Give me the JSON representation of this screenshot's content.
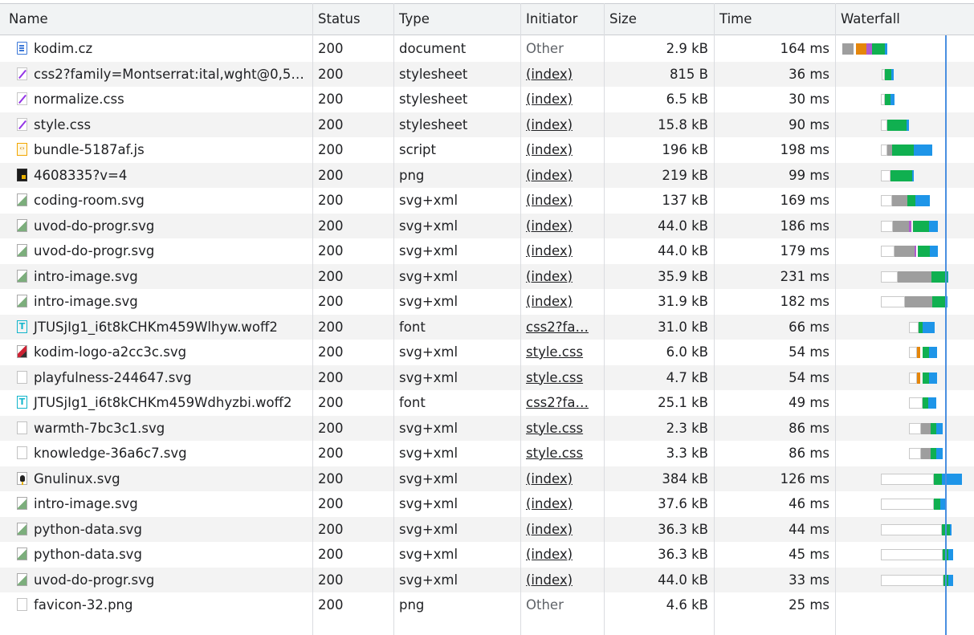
{
  "columns": {
    "name": "Name",
    "status": "Status",
    "type": "Type",
    "initiator": "Initiator",
    "size": "Size",
    "time": "Time",
    "waterfall": "Waterfall"
  },
  "colors": {
    "queueing": "#ffffff",
    "stalled": "#9e9e9e",
    "ssl": "#e5860b",
    "connect": "#b05ad0",
    "waiting": "#10b050",
    "download": "#1e95e8",
    "load_marker": "#4a8fe0",
    "row_alt": "#f3f3f3"
  },
  "requests": [
    {
      "name": "kodim.cz",
      "icon": "document-icon",
      "status": "200",
      "type": "document",
      "initiator": "Other",
      "initiator_link": false,
      "size": "2.9 kB",
      "time": "164 ms"
    },
    {
      "name": "css2?family=Montserrat:ital,wght@0,5…",
      "icon": "stylesheet-icon",
      "status": "200",
      "type": "stylesheet",
      "initiator": "(index)",
      "initiator_link": true,
      "size": "815 B",
      "time": "36 ms"
    },
    {
      "name": "normalize.css",
      "icon": "stylesheet-icon",
      "status": "200",
      "type": "stylesheet",
      "initiator": "(index)",
      "initiator_link": true,
      "size": "6.5 kB",
      "time": "30 ms"
    },
    {
      "name": "style.css",
      "icon": "stylesheet-icon",
      "status": "200",
      "type": "stylesheet",
      "initiator": "(index)",
      "initiator_link": true,
      "size": "15.8 kB",
      "time": "90 ms"
    },
    {
      "name": "bundle-5187af.js",
      "icon": "script-icon",
      "status": "200",
      "type": "script",
      "initiator": "(index)",
      "initiator_link": true,
      "size": "196 kB",
      "time": "198 ms"
    },
    {
      "name": "4608335?v=4",
      "icon": "png-thumbnail-icon",
      "status": "200",
      "type": "png",
      "initiator": "(index)",
      "initiator_link": true,
      "size": "219 kB",
      "time": "99 ms"
    },
    {
      "name": "coding-room.svg",
      "icon": "image-icon",
      "status": "200",
      "type": "svg+xml",
      "initiator": "(index)",
      "initiator_link": true,
      "size": "137 kB",
      "time": "169 ms"
    },
    {
      "name": "uvod-do-progr.svg",
      "icon": "image-icon",
      "status": "200",
      "type": "svg+xml",
      "initiator": "(index)",
      "initiator_link": true,
      "size": "44.0 kB",
      "time": "186 ms"
    },
    {
      "name": "uvod-do-progr.svg",
      "icon": "image-icon",
      "status": "200",
      "type": "svg+xml",
      "initiator": "(index)",
      "initiator_link": true,
      "size": "44.0 kB",
      "time": "179 ms"
    },
    {
      "name": "intro-image.svg",
      "icon": "image-icon",
      "status": "200",
      "type": "svg+xml",
      "initiator": "(index)",
      "initiator_link": true,
      "size": "35.9 kB",
      "time": "231 ms"
    },
    {
      "name": "intro-image.svg",
      "icon": "image-icon",
      "status": "200",
      "type": "svg+xml",
      "initiator": "(index)",
      "initiator_link": true,
      "size": "31.9 kB",
      "time": "182 ms"
    },
    {
      "name": "JTUSjIg1_i6t8kCHKm459Wlhyw.woff2",
      "icon": "font-icon",
      "status": "200",
      "type": "font",
      "initiator": "css2?fa…",
      "initiator_link": true,
      "size": "31.0 kB",
      "time": "66 ms"
    },
    {
      "name": "kodim-logo-a2cc3c.svg",
      "icon": "logo-icon",
      "status": "200",
      "type": "svg+xml",
      "initiator": "style.css",
      "initiator_link": true,
      "size": "6.0 kB",
      "time": "54 ms"
    },
    {
      "name": "playfulness-244647.svg",
      "icon": "blank-icon",
      "status": "200",
      "type": "svg+xml",
      "initiator": "style.css",
      "initiator_link": true,
      "size": "4.7 kB",
      "time": "54 ms"
    },
    {
      "name": "JTUSjIg1_i6t8kCHKm459Wdhyzbi.woff2",
      "icon": "font-icon",
      "status": "200",
      "type": "font",
      "initiator": "css2?fa…",
      "initiator_link": true,
      "size": "25.1 kB",
      "time": "49 ms"
    },
    {
      "name": "warmth-7bc3c1.svg",
      "icon": "blank-icon",
      "status": "200",
      "type": "svg+xml",
      "initiator": "style.css",
      "initiator_link": true,
      "size": "2.3 kB",
      "time": "86 ms"
    },
    {
      "name": "knowledge-36a6c7.svg",
      "icon": "blank-icon",
      "status": "200",
      "type": "svg+xml",
      "initiator": "style.css",
      "initiator_link": true,
      "size": "3.3 kB",
      "time": "86 ms"
    },
    {
      "name": "Gnulinux.svg",
      "icon": "tux-icon",
      "status": "200",
      "type": "svg+xml",
      "initiator": "(index)",
      "initiator_link": true,
      "size": "384 kB",
      "time": "126 ms"
    },
    {
      "name": "intro-image.svg",
      "icon": "image-icon",
      "status": "200",
      "type": "svg+xml",
      "initiator": "(index)",
      "initiator_link": true,
      "size": "37.6 kB",
      "time": "46 ms"
    },
    {
      "name": "python-data.svg",
      "icon": "image-icon",
      "status": "200",
      "type": "svg+xml",
      "initiator": "(index)",
      "initiator_link": true,
      "size": "36.3 kB",
      "time": "44 ms"
    },
    {
      "name": "python-data.svg",
      "icon": "image-icon",
      "status": "200",
      "type": "svg+xml",
      "initiator": "(index)",
      "initiator_link": true,
      "size": "36.3 kB",
      "time": "45 ms"
    },
    {
      "name": "uvod-do-progr.svg",
      "icon": "image-icon",
      "status": "200",
      "type": "svg+xml",
      "initiator": "(index)",
      "initiator_link": true,
      "size": "44.0 kB",
      "time": "33 ms"
    },
    {
      "name": "favicon-32.png",
      "icon": "blank-icon",
      "status": "200",
      "type": "png",
      "initiator": "Other",
      "initiator_link": false,
      "size": "4.6 kB",
      "time": "25 ms"
    }
  ]
}
